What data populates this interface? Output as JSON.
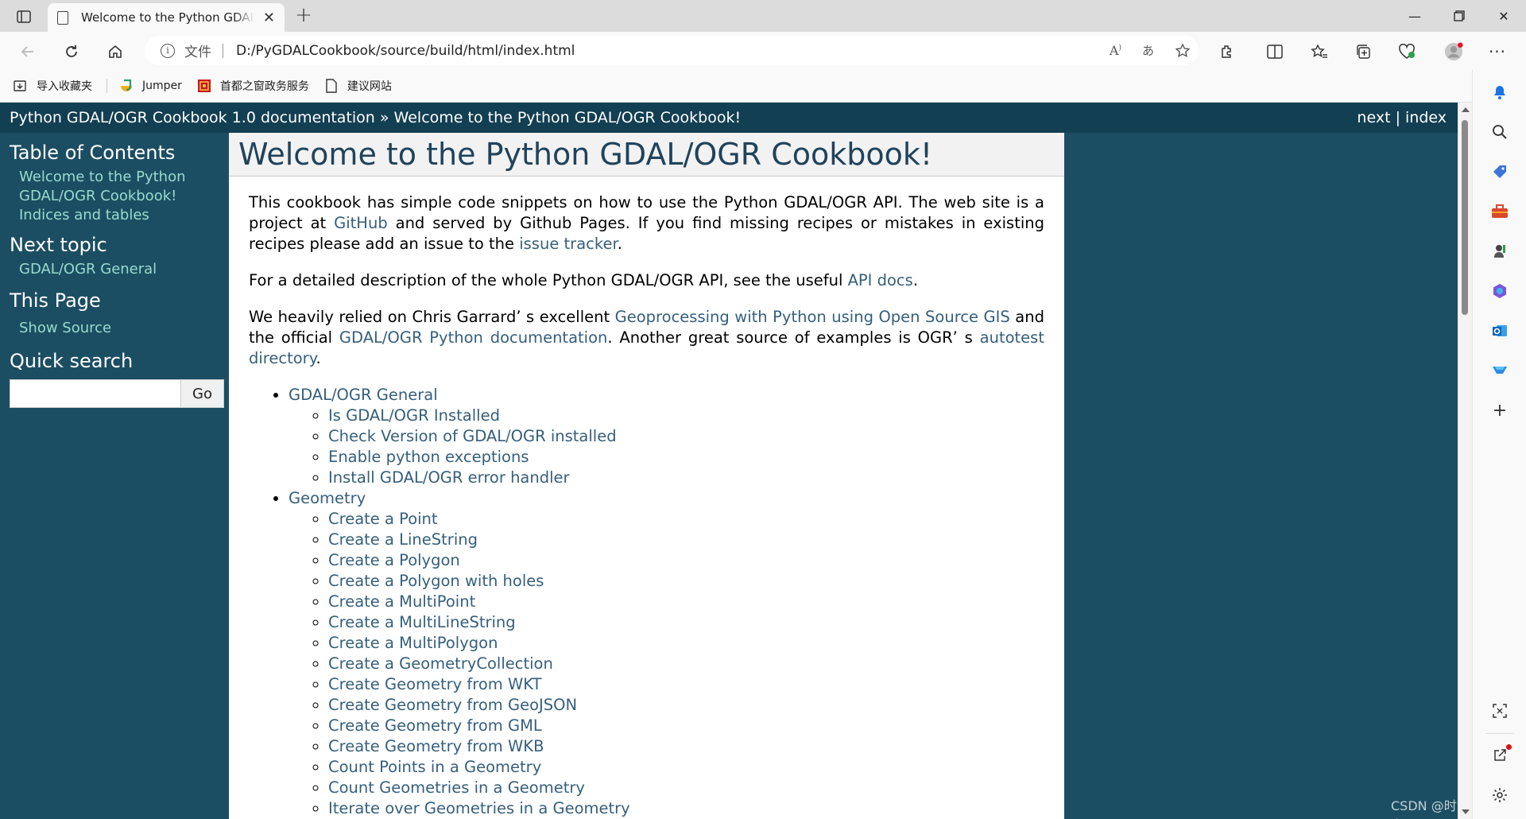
{
  "browser": {
    "tab_title": "Welcome to the Python GDAL/OGR Cookbook!",
    "scheme_label": "文件",
    "url": "D:/PyGDALCookbook/source/build/html/index.html",
    "bookmarks": [
      "导入收藏夹",
      "Jumper",
      "首都之窗政务服务",
      "建议网站"
    ]
  },
  "page": {
    "related_left": "Python GDAL/OGR Cookbook 1.0 documentation » Welcome to the Python GDAL/OGR Cookbook!",
    "nav_next": "next",
    "nav_sep": "|",
    "nav_index": "index",
    "sidebar": {
      "toc_heading": "Table of Contents",
      "toc_items": [
        "Welcome to the Python GDAL/OGR Cookbook!",
        "Indices and tables"
      ],
      "next_heading": "Next topic",
      "next_item": "GDAL/OGR General",
      "this_page_heading": "This Page",
      "show_source": "Show Source",
      "search_heading": "Quick search",
      "search_button": "Go"
    },
    "title": "Welcome to the Python GDAL/OGR Cookbook!",
    "p1": {
      "t1": "This cookbook has simple code snippets on how to use the Python GDAL/OGR API. The web site is a project at ",
      "l1": "GitHub",
      "t2": " and served by Github Pages. If you find missing recipes or mistakes in existing recipes please add an issue to the ",
      "l2": "issue tracker",
      "t3": "."
    },
    "p2": {
      "t1": "For a detailed description of the whole Python GDAL/OGR API, see the useful ",
      "l1": "API docs",
      "t2": "."
    },
    "p3": {
      "t1": "We heavily relied on Chris Garrard’ s excellent ",
      "l1": "Geoprocessing with Python using Open Source GIS",
      "t2": " and the official ",
      "l2": "GDAL/OGR Python documentation",
      "t3": ". Another great source of examples is OGR’ s ",
      "l3": "autotest directory",
      "t4": "."
    },
    "toc": [
      {
        "label": "GDAL/OGR General",
        "children": [
          "Is GDAL/OGR Installed",
          "Check Version of GDAL/OGR installed",
          "Enable python exceptions",
          "Install GDAL/OGR error handler"
        ]
      },
      {
        "label": "Geometry",
        "children": [
          "Create a Point",
          "Create a LineString",
          "Create a Polygon",
          "Create a Polygon with holes",
          "Create a MultiPoint",
          "Create a MultiLineString",
          "Create a MultiPolygon",
          "Create a GeometryCollection",
          "Create Geometry from WKT",
          "Create Geometry from GeoJSON",
          "Create Geometry from GML",
          "Create Geometry from WKB",
          "Count Points in a Geometry",
          "Count Geometries in a Geometry",
          "Iterate over Geometries in a Geometry"
        ]
      }
    ]
  },
  "watermark": "CSDN @时空worker",
  "colors": {
    "page_bg": "#1c4e63",
    "related_bar": "#133f52",
    "link": "#355f7c",
    "sidebar_link": "#98dbcc"
  }
}
